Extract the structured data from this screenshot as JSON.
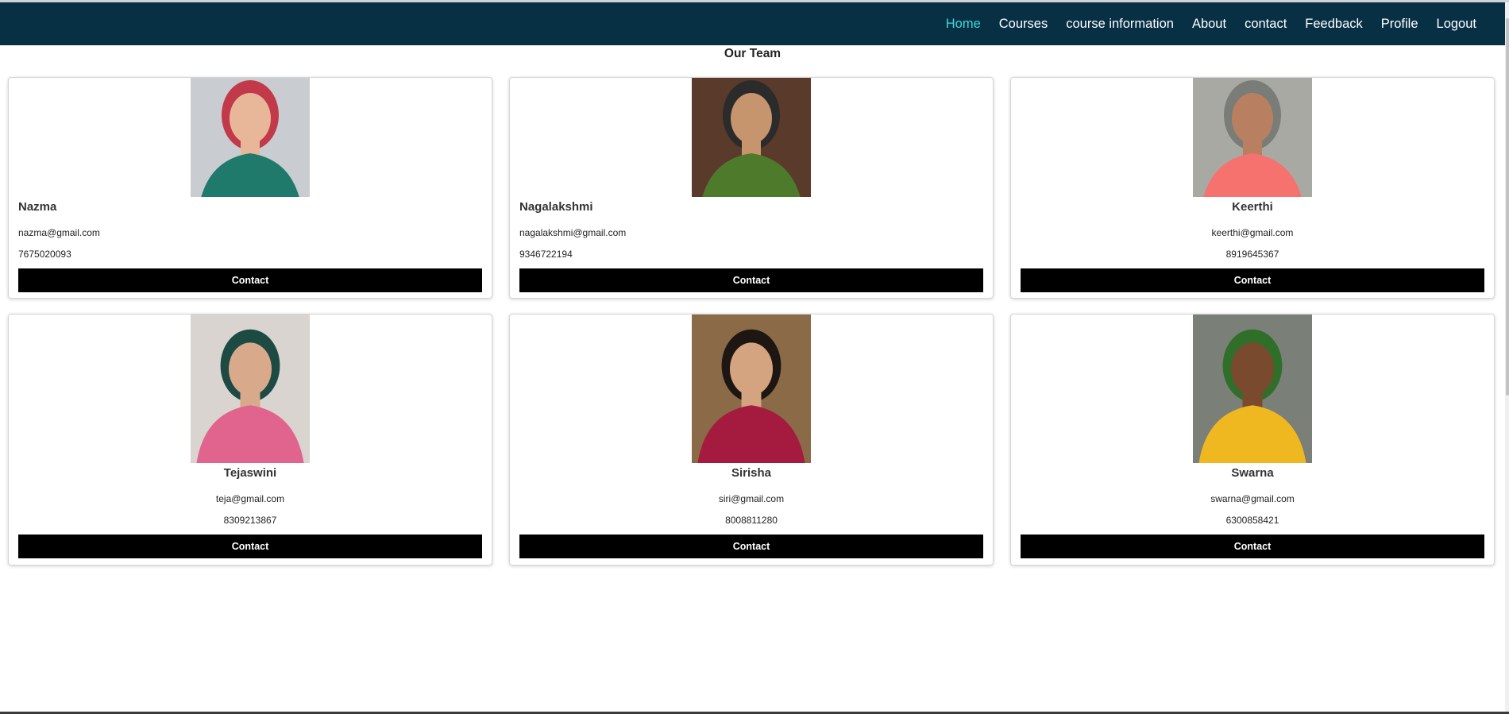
{
  "nav": {
    "items": [
      {
        "label": "Home",
        "active": true
      },
      {
        "label": "Courses",
        "active": false
      },
      {
        "label": "course information",
        "active": false
      },
      {
        "label": "About",
        "active": false
      },
      {
        "label": "contact",
        "active": false
      },
      {
        "label": "Feedback",
        "active": false
      },
      {
        "label": "Profile",
        "active": false
      },
      {
        "label": "Logout",
        "active": false
      }
    ]
  },
  "page": {
    "title": "Our Team"
  },
  "team": [
    {
      "name": "Nazma",
      "email": "nazma@gmail.com",
      "phone": "7675020093",
      "button": "Contact",
      "align": "left",
      "photo_colors": [
        "#c9ccd0",
        "#1f7a6b",
        "#c23a4a",
        "#e8b79a"
      ]
    },
    {
      "name": "Nagalakshmi",
      "email": "nagalakshmi@gmail.com",
      "phone": "9346722194",
      "button": "Contact",
      "align": "left",
      "photo_colors": [
        "#5a3a2a",
        "#4e7a2c",
        "#2b2b2b",
        "#c6946d"
      ]
    },
    {
      "name": "Keerthi",
      "email": "keerthi@gmail.com",
      "phone": "8919645367",
      "button": "Contact",
      "align": "center",
      "photo_colors": [
        "#a9a9a4",
        "#f5726e",
        "#7a7c78",
        "#b88060"
      ]
    },
    {
      "name": "Tejaswini",
      "email": "teja@gmail.com",
      "phone": "8309213867",
      "button": "Contact",
      "align": "center",
      "photo_colors": [
        "#d9d4cf",
        "#e0648e",
        "#1d4a43",
        "#d9a98c"
      ]
    },
    {
      "name": "Sirisha",
      "email": "siri@gmail.com",
      "phone": "8008811280",
      "button": "Contact",
      "align": "center",
      "photo_colors": [
        "#8b6a47",
        "#a41b3f",
        "#1e1612",
        "#d4a37f"
      ]
    },
    {
      "name": "Swarna",
      "email": "swarna@gmail.com",
      "phone": "6300858421",
      "button": "Contact",
      "align": "center",
      "photo_colors": [
        "#7a7f78",
        "#f0b820",
        "#2f6f2a",
        "#7a4a2f"
      ]
    }
  ]
}
